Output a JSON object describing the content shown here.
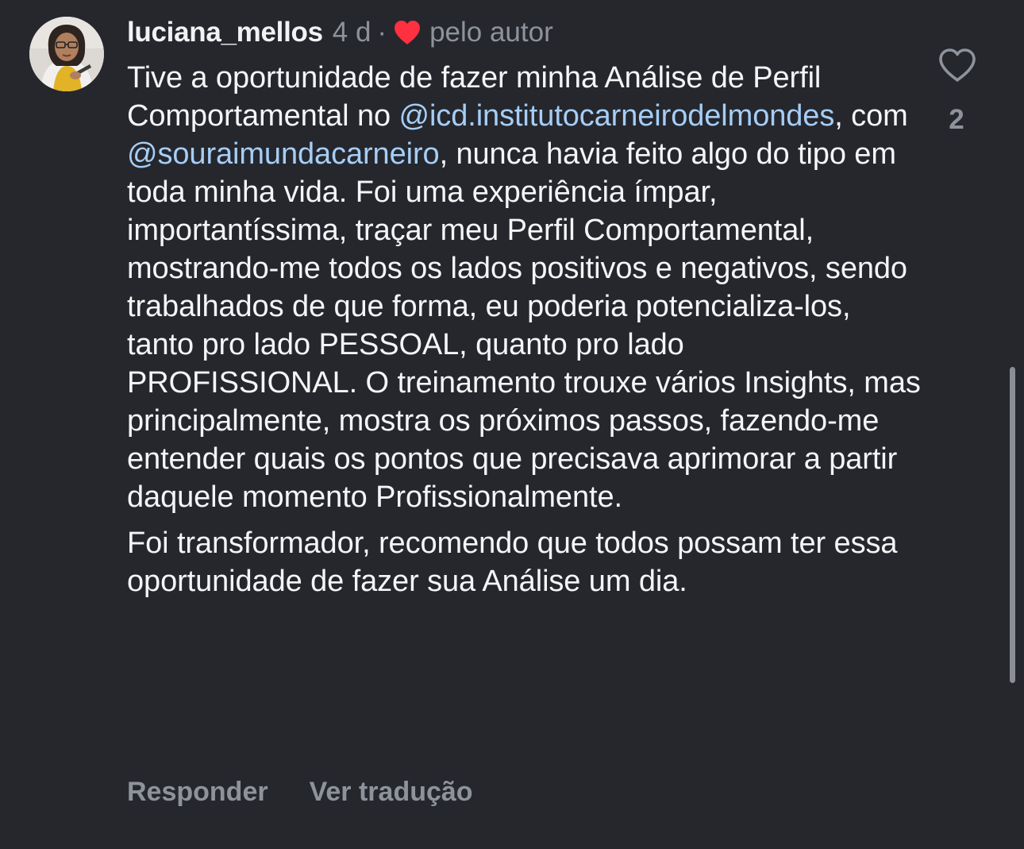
{
  "comment": {
    "username": "luciana_mellos",
    "time_ago": "4 d",
    "separator": "·",
    "liked_by_author_label": "pelo autor",
    "paragraph1": {
      "t1": "Tive a oportunidade de fazer minha Análise de Perfil Comportamental no ",
      "mention1": "@icd.institutocarneirodelmondes",
      "t2": ", com ",
      "mention2": "@souraimundacarneiro",
      "t3": ", nunca havia feito algo do tipo em toda minha vida. Foi uma experiência ímpar, importantíssima, traçar meu Perfil Comportamental, mostrando-me todos os lados positivos e negativos, sendo trabalhados de que forma, eu poderia potencializa-los, tanto pro lado PESSOAL, quanto pro lado PROFISSIONAL. O treinamento trouxe vários Insights, mas principalmente, mostra os próximos passos, fazendo-me entender quais os pontos que precisava aprimorar a partir daquele momento Profissionalmente."
    },
    "paragraph2": "Foi transformador, recomendo que todos possam ter essa oportunidade de fazer sua Análise um dia.",
    "reply_label": "Responder",
    "translate_label": "Ver tradução",
    "like_count": "2"
  },
  "colors": {
    "background": "#25272d",
    "text": "#f5f5f7",
    "muted": "#8e939b",
    "mention": "#a6cdf6",
    "author_heart": "#ff3040"
  },
  "icons": {
    "author_like": "heart-filled-icon",
    "like_button": "heart-outline-icon"
  }
}
